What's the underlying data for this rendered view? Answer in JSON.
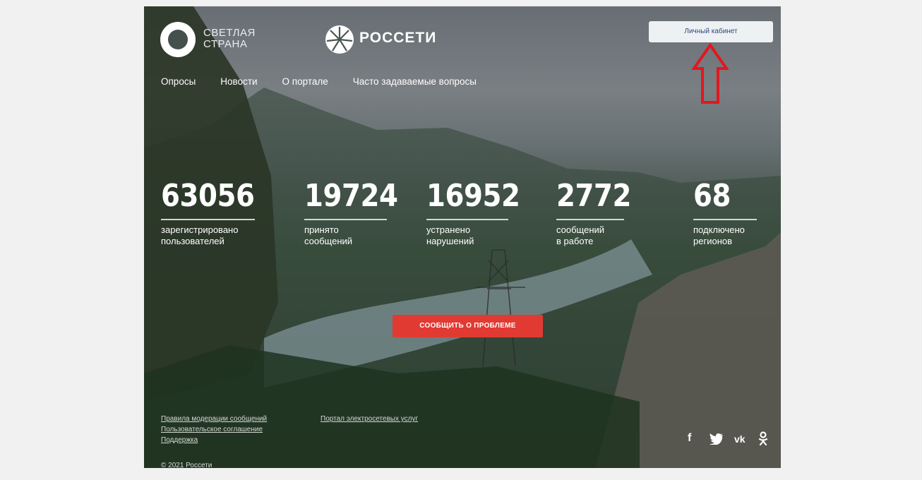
{
  "brand": {
    "logo_text_line1": "СВЕТЛАЯ",
    "logo_text_line2": "СТРАНА",
    "partner_name": "РОССЕТИ"
  },
  "header": {
    "cabinet_button": "Личный кабинет"
  },
  "nav": {
    "items": [
      {
        "label": "Опросы"
      },
      {
        "label": "Новости"
      },
      {
        "label": "О портале"
      },
      {
        "label": "Часто задаваемые вопросы"
      }
    ]
  },
  "stats": [
    {
      "value": "63056",
      "label": "зарегистрировано\nпользователей"
    },
    {
      "value": "19724",
      "label": "принято\nсообщений"
    },
    {
      "value": "16952",
      "label": "устранено\nнарушений"
    },
    {
      "value": "2772",
      "label": "сообщений\nв работе"
    },
    {
      "value": "68",
      "label": "подключено\nрегионов"
    }
  ],
  "cta": {
    "report_button": "СООБЩИТЬ О ПРОБЛЕМЕ"
  },
  "footer": {
    "links": [
      {
        "label": "Правила модерации сообщений"
      },
      {
        "label": "Пользовательское соглашение"
      },
      {
        "label": "Поддержка"
      }
    ],
    "portal_link": "Портал электросетевых услуг",
    "copyright": "© 2021 Россети"
  },
  "social": [
    {
      "icon": "facebook-icon",
      "glyph": "f"
    },
    {
      "icon": "twitter-icon",
      "glyph": "🐦"
    },
    {
      "icon": "vk-icon",
      "glyph": "vk"
    },
    {
      "icon": "odnoklassniki-icon",
      "glyph": "ok"
    }
  ],
  "colors": {
    "accent_red": "#e13a33",
    "annotation_arrow": "#e3171d",
    "button_bg": "#eef1f4"
  }
}
